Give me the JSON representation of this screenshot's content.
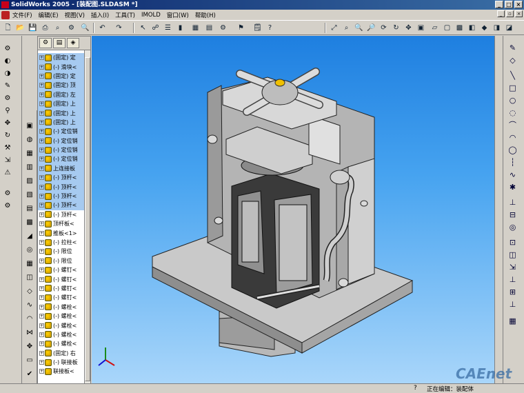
{
  "window": {
    "title": "SolidWorks 2005 - [装配图.SLDASM *]"
  },
  "menu": {
    "items": [
      "文件(F)",
      "编辑(E)",
      "视图(V)",
      "插入(I)",
      "工具(T)",
      "IMOLD",
      "窗口(W)",
      "帮助(H)"
    ]
  },
  "tree": {
    "items": [
      "(固定) 定",
      "(-) 滑块<",
      "(固定) 定",
      "(固定) 顶",
      "(固定) 左",
      "(固定) 上",
      "(固定) 上",
      "(固定) 上",
      "(-) 定位销",
      "(-) 定位销",
      "(-) 定位销",
      "(-) 定位销",
      "上连接板",
      "(-) 顶杆<",
      "(-) 顶杆<",
      "(-) 顶杆<",
      "(-) 顶杆<",
      "(-) 顶杆<",
      "顶杆板<",
      "推板<1>",
      "(-) 拉柱<",
      "(-) 限位",
      "(-) 限位",
      "(-) 螺钉<",
      "(-) 螺钉<",
      "(-) 螺钉<",
      "(-) 螺钉<",
      "(-) 螺栓<",
      "(-) 螺栓<",
      "(-) 螺栓<",
      "(-) 螺栓<",
      "(-) 螺栓<",
      "(固定) 右",
      "(-) 联接板",
      "联接板<"
    ]
  },
  "status": {
    "edit": "正在编辑：装配体",
    "help_icon": "?"
  },
  "watermark": "CAEnet"
}
